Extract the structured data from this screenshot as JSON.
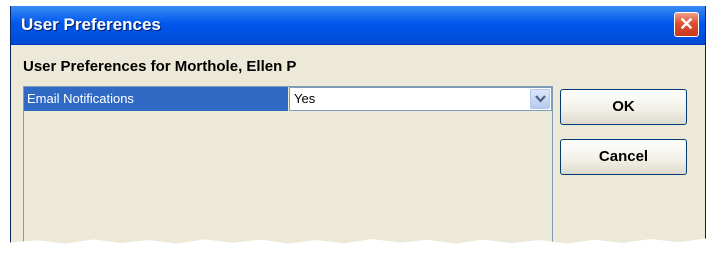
{
  "window": {
    "title": "User Preferences",
    "close_symbol": "✕"
  },
  "header": {
    "subtitle": "User Preferences for Morthole, Ellen P"
  },
  "preferences": [
    {
      "label": "Email Notifications",
      "value": "Yes"
    }
  ],
  "buttons": {
    "ok": "OK",
    "cancel": "Cancel"
  }
}
